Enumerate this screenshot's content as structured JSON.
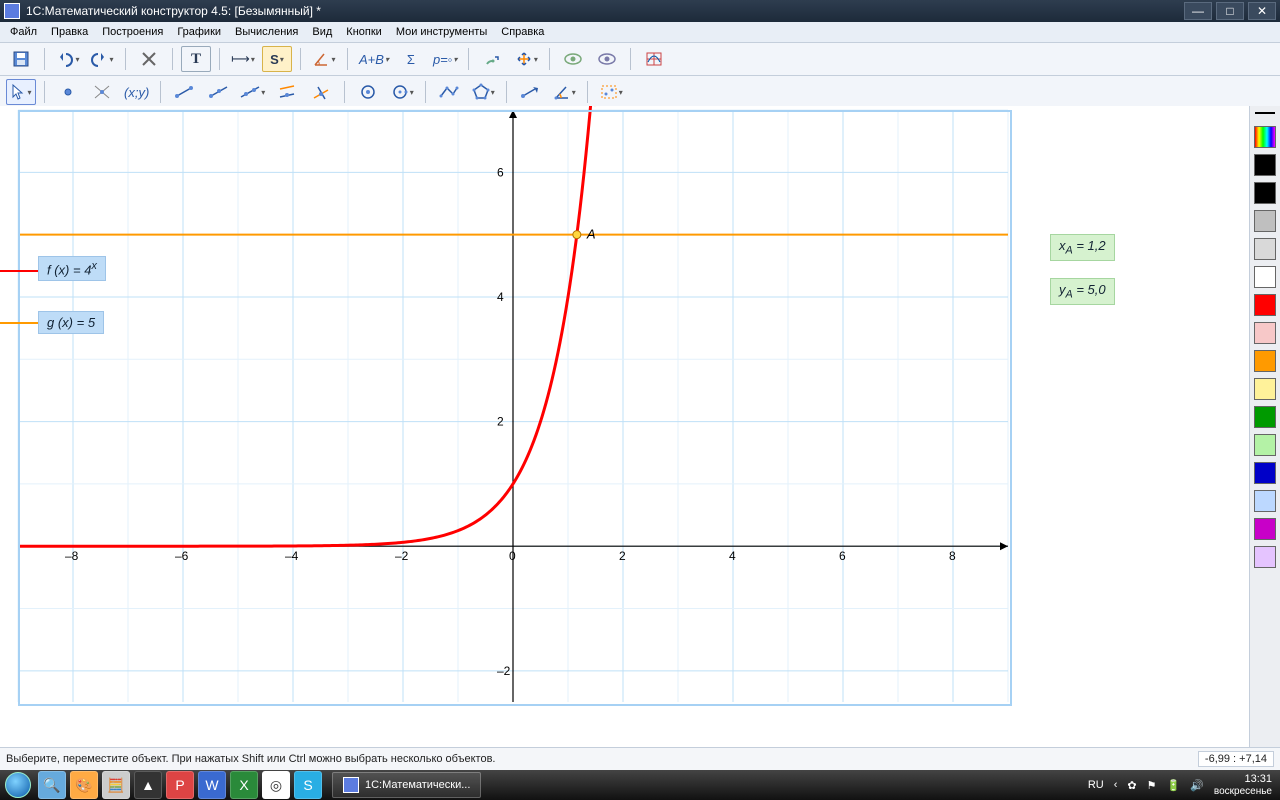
{
  "title": "1С:Математический конструктор 4.5: [Безымянный] *",
  "menu": [
    "Файл",
    "Правка",
    "Построения",
    "Графики",
    "Вычисления",
    "Вид",
    "Кнопки",
    "Мои инструменты",
    "Справка"
  ],
  "status_hint": "Выберите, переместите объект. При нажатых Shift или Ctrl можно выбрать несколько объектов.",
  "status_coords": "-6,99 : +7,14",
  "func_f": "f (x)  = 4",
  "func_f_sup": "x",
  "func_g": "g (x)  = 5",
  "point_label": "A",
  "info_xa": "x",
  "info_xa_sub": "A",
  "info_xa_val": " = 1,2",
  "info_ya": "y",
  "info_ya_sub": "A",
  "info_ya_val": " = 5,0",
  "colors": [
    "#000000",
    "#000000",
    "#bfbfbf",
    "#d9d9d9",
    "#ffffff",
    "#ff0000",
    "#f7c8c8",
    "#ff9a00",
    "#fff29a",
    "#009a00",
    "#b4f2a6",
    "#0000c8",
    "#bcd8ff",
    "#c800c8",
    "#e5c4ff"
  ],
  "taskbar_app": "1С:Математически...",
  "lang": "RU",
  "clock": "13:31",
  "day": "воскресенье",
  "chart_data": {
    "type": "line",
    "xlim": [
      -9,
      9
    ],
    "ylim": [
      -2.5,
      7
    ],
    "xticks": [
      -8,
      -6,
      -4,
      -2,
      0,
      2,
      4,
      6,
      8
    ],
    "yticks": [
      -2,
      0,
      2,
      4,
      6
    ],
    "series": [
      {
        "name": "f(x)=4^x",
        "color": "#ff0000",
        "expr": "4**x"
      },
      {
        "name": "g(x)=5",
        "color": "#ff9a00",
        "expr": "5"
      }
    ],
    "intersection": {
      "label": "A",
      "x": 1.160964,
      "y": 5.0
    }
  }
}
